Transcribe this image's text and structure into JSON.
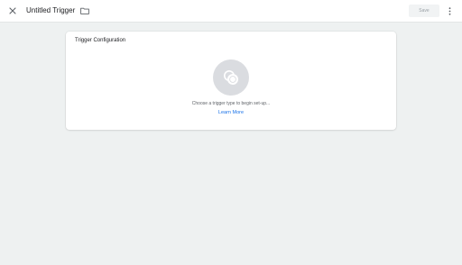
{
  "topbar": {
    "title": "Untitled Trigger",
    "save_label": "Save",
    "icons": {
      "close": "close-icon",
      "folder": "folder-icon",
      "more": "more-vert-icon"
    }
  },
  "card": {
    "title": "Trigger Configuration",
    "prompt": "Choose a trigger type to begin set-up...",
    "learn_more": "Learn More",
    "icon": "trigger-type-icon"
  },
  "colors": {
    "background": "#eef1f1",
    "card": "#ffffff",
    "circle": "#dadce0",
    "link": "#1a73e8",
    "muted": "#5f6368"
  }
}
